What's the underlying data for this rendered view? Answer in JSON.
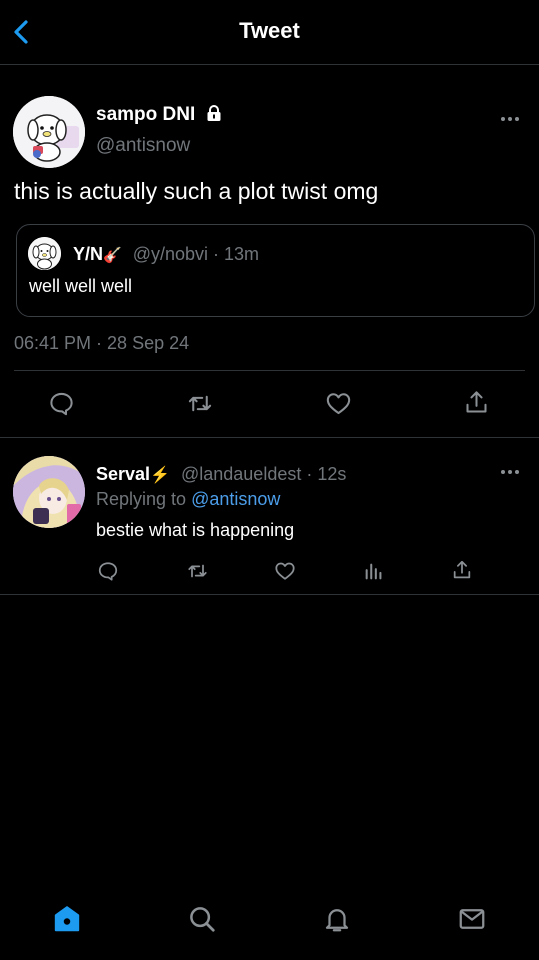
{
  "header": {
    "title": "Tweet"
  },
  "tweet": {
    "name": "sampo DNI",
    "handle": "@antisnow",
    "text": "this is actually such a plot twist omg",
    "timestamp": "06:41 PM · 28 Sep 24",
    "quote": {
      "name": "Y/N",
      "name_emoji": "🎸",
      "handle_time": "@y/nobvi · 13m",
      "text": "well well well"
    }
  },
  "reply": {
    "name": "Serval",
    "name_emoji": "⚡",
    "handle_time": "@landaueldest · 12s",
    "replying_prefix": "Replying to",
    "replying_to": "@antisnow",
    "text": "bestie what is happening"
  },
  "icons": {
    "main_actions": [
      "reply-icon",
      "retweet-icon",
      "like-icon",
      "share-icon"
    ],
    "reply_actions": [
      "reply-icon",
      "retweet-icon",
      "like-icon",
      "analytics-icon",
      "share-icon"
    ],
    "bottom_nav": [
      "home-icon",
      "search-icon",
      "notifications-icon",
      "messages-icon"
    ]
  },
  "colors": {
    "accent": "#1d9bf0",
    "link": "#4c9eeb",
    "background": "#000000",
    "muted": "#71767b"
  }
}
